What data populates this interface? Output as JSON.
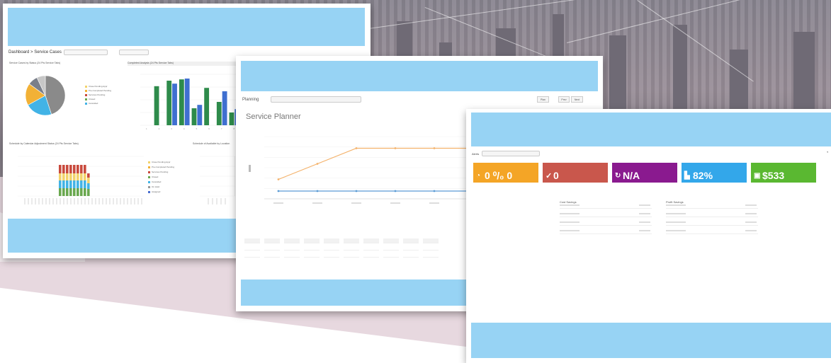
{
  "colors": {
    "banner": "#97d3f4",
    "orange": "#f4a526",
    "red": "#c9574c",
    "purple": "#8a1a8f",
    "blue": "#33a7ea",
    "green": "#5ab831"
  },
  "window1": {
    "title": "Dashboard > Service Cases",
    "chart_titles": {
      "pie": "Service Cases by Status (24 Pts Service Tabs)",
      "bar": "Completed Analysis (24 Pts Service Tabs)",
      "stacked": "Schedule by Calendar Adjustment Status (24 Pts Service Tabs)",
      "right": "Schedule of Available by Location"
    },
    "legend": [
      "Close Pending Appr",
      "Pre-Completed Pending",
      "Services Pending",
      "Closed",
      "Cancelled",
      "On Hold",
      "Assigned"
    ]
  },
  "window2": {
    "toolbar_label": "Planning",
    "heading": "Service Planner",
    "buttons": [
      "Plan",
      "Prev",
      "Next"
    ]
  },
  "window3": {
    "toolbar_label": "Alerts",
    "tiles": [
      {
        "icon": "clock-icon",
        "value": "0 ⁰/₀ 0"
      },
      {
        "icon": "check-icon",
        "value": "0"
      },
      {
        "icon": "refresh-icon",
        "value": "N/A"
      },
      {
        "icon": "chart-icon",
        "value": "82%"
      },
      {
        "icon": "dollar-icon",
        "value": "$533"
      }
    ],
    "summary_left_head": "Cost Savings",
    "summary_right_head": "Profit Savings"
  },
  "chart_data": [
    {
      "type": "pie",
      "title": "",
      "values": [
        45,
        22,
        18,
        8,
        7
      ],
      "colors": [
        "#8a8a8a",
        "#42b3e6",
        "#f2b136",
        "#7a7f8a",
        "#c7c7c7"
      ]
    },
    {
      "type": "bar",
      "title": "",
      "categories": [
        "1",
        "2",
        "3",
        "4",
        "5",
        "6",
        "7",
        "8",
        "9",
        "10",
        "11",
        "12",
        "13",
        "14",
        "15",
        "16",
        "17"
      ],
      "series": [
        {
          "values": [
            0,
            92,
            105,
            108,
            40,
            88,
            55,
            30,
            60,
            45,
            20,
            5,
            0,
            0,
            0,
            0,
            0
          ]
        },
        {
          "values": [
            0,
            0,
            98,
            110,
            48,
            0,
            80,
            38,
            70,
            0,
            25,
            0,
            0,
            0,
            0,
            0,
            0
          ]
        }
      ],
      "ylim": [
        0,
        120
      ]
    },
    {
      "type": "line",
      "title": "",
      "x": [
        1,
        2,
        3,
        4,
        5,
        6,
        7
      ],
      "series": [
        {
          "values": [
            25,
            45,
            65,
            65,
            65,
            65,
            65
          ]
        },
        {
          "values": [
            10,
            10,
            10,
            10,
            10,
            10,
            10
          ]
        }
      ],
      "ylim": [
        0,
        80
      ]
    }
  ]
}
